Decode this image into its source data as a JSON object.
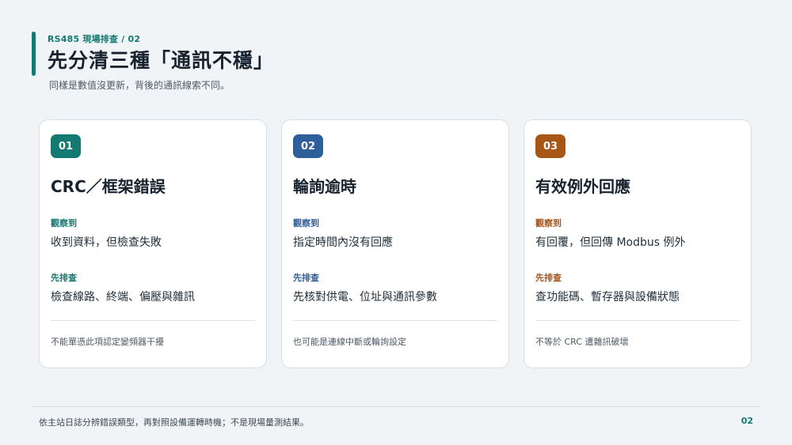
{
  "header": {
    "kicker": "RS485 現場排查 / 02",
    "title": "先分清三種「通訊不穩」",
    "subtitle": "同樣是數值沒更新，背後的通訊線索不同。"
  },
  "cards": [
    {
      "number": "01",
      "accent": "#137a72",
      "title": "CRC／框架錯誤",
      "observe_label": "觀察到",
      "observe_text": "收到資料，但檢查失敗",
      "check_label": "先排查",
      "check_text": "檢查線路、終端、偏壓與雜訊",
      "note": "不能單憑此項認定變頻器干擾"
    },
    {
      "number": "02",
      "accent": "#2f5f9a",
      "title": "輪詢逾時",
      "observe_label": "觀察到",
      "observe_text": "指定時間內沒有回應",
      "check_label": "先排查",
      "check_text": "先核對供電、位址與通訊參數",
      "note": "也可能是連線中斷或輪詢設定"
    },
    {
      "number": "03",
      "accent": "#a85618",
      "title": "有效例外回應",
      "observe_label": "觀察到",
      "observe_text": "有回覆，但回傳 Modbus 例外",
      "check_label": "先排查",
      "check_text": "查功能碼、暫存器與設備狀態",
      "note": "不等於 CRC 遭雜訊破壞"
    }
  ],
  "footer": {
    "text": "依主站日誌分辨錯誤類型，再對照設備運轉時機；不是現場量測結果。",
    "page_number": "02"
  }
}
